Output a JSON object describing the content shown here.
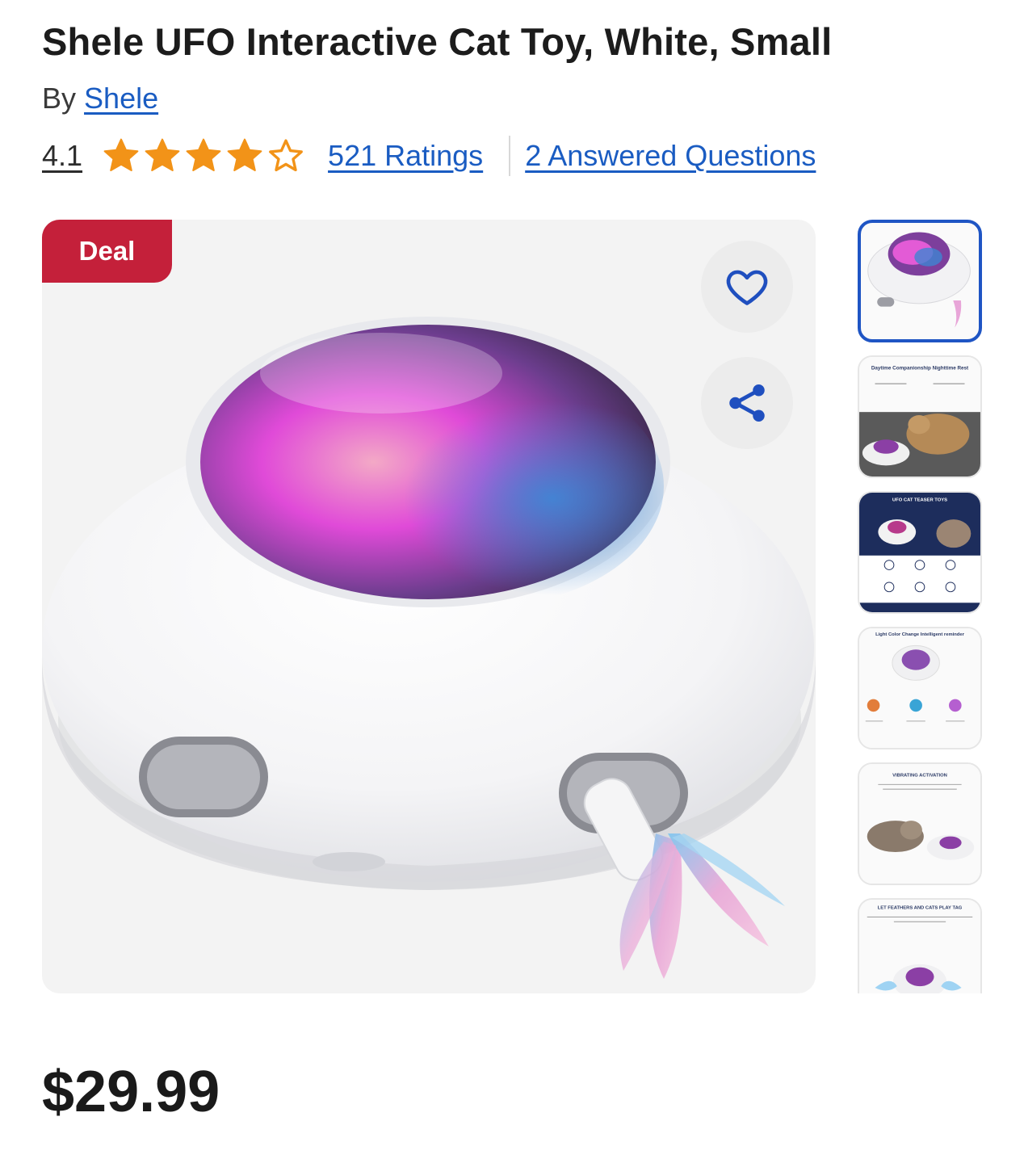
{
  "product": {
    "title": "Shele UFO Interactive Cat Toy, White, Small",
    "by_label": "By",
    "brand": "Shele",
    "rating_value": "4.1",
    "rating_stars": 4.1,
    "ratings_link": "521 Ratings",
    "questions_link": "2 Answered Questions",
    "price": "$29.99"
  },
  "gallery": {
    "badge": "Deal",
    "favorite_icon": "heart-icon",
    "share_icon": "share-icon",
    "thumbnails": [
      {
        "name": "thumbnail-1",
        "caption_title": "",
        "selected": true
      },
      {
        "name": "thumbnail-2",
        "caption_title": "Daytime Companionship Nighttime Rest",
        "selected": false
      },
      {
        "name": "thumbnail-3",
        "caption_title": "UFO CAT TEASER TOYS",
        "selected": false
      },
      {
        "name": "thumbnail-4",
        "caption_title": "Light Color Change Intelligent reminder",
        "selected": false
      },
      {
        "name": "thumbnail-5",
        "caption_title": "VIBRATING ACTIVATION",
        "selected": false
      },
      {
        "name": "thumbnail-6",
        "caption_title": "LET FEATHERS AND CATS PLAY TAG",
        "selected": false
      }
    ]
  },
  "colors": {
    "link": "#1a5cc2",
    "star": "#f29318",
    "deal": "#c4203a",
    "selected_border": "#1f55c4"
  }
}
